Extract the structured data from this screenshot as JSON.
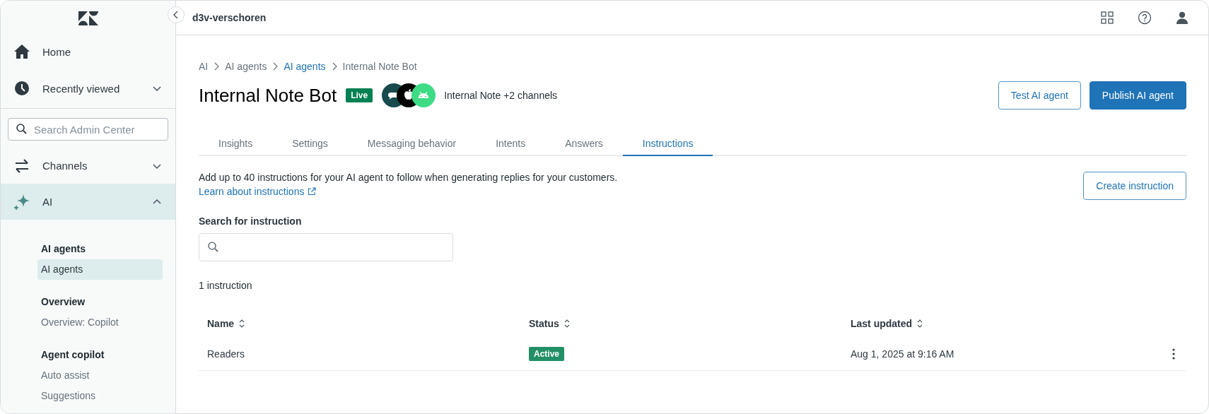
{
  "sidebar": {
    "home": {
      "label": "Home"
    },
    "recent": {
      "label": "Recently viewed",
      "expanded": false
    },
    "search": {
      "placeholder": "Search Admin Center"
    },
    "nav_items": [
      {
        "label": "Channels",
        "expanded": false,
        "selected": false
      },
      {
        "label": "AI",
        "expanded": true,
        "selected": true
      }
    ],
    "sections": [
      {
        "title": "AI agents",
        "items": [
          {
            "label": "AI agents",
            "selected": true
          }
        ]
      },
      {
        "title": "Overview",
        "items": [
          {
            "label": "Overview: Copilot",
            "selected": false
          }
        ]
      },
      {
        "title": "Agent copilot",
        "items": [
          {
            "label": "Auto assist",
            "selected": false
          },
          {
            "label": "Suggestions",
            "selected": false
          }
        ]
      }
    ]
  },
  "header": {
    "workspace": "d3v-verschoren"
  },
  "breadcrumbs": [
    {
      "label": "AI",
      "link": false
    },
    {
      "label": "AI agents",
      "link": false
    },
    {
      "label": "AI agents",
      "link": true
    },
    {
      "label": "Internal Note Bot",
      "link": false
    }
  ],
  "page": {
    "title": "Internal Note Bot",
    "status": "Live",
    "channels_text": "Internal Note +2 channels"
  },
  "buttons": [
    {
      "label": "Test AI agent",
      "kind": "secondary"
    },
    {
      "label": "Publish AI agent",
      "kind": "primary"
    }
  ],
  "tabs": [
    {
      "label": "Insights",
      "selected": false
    },
    {
      "label": "Settings",
      "selected": false
    },
    {
      "label": "Messaging behavior",
      "selected": false
    },
    {
      "label": "Intents",
      "selected": false
    },
    {
      "label": "Answers",
      "selected": false
    },
    {
      "label": "Instructions",
      "selected": true
    }
  ],
  "instructions": {
    "description": "Add up to 40 instructions for your AI agent to follow when generating replies for your customers.",
    "learn_link": "Learn about instructions",
    "create_button": "Create instruction",
    "search_label": "Search for instruction",
    "count": "1 instruction"
  },
  "table": {
    "columns": [
      "Name",
      "Status",
      "Last updated"
    ],
    "rows": [
      {
        "name": "Readers",
        "status": "Active",
        "updated": "Aug 1, 2025 at 9:16 AM"
      }
    ]
  }
}
